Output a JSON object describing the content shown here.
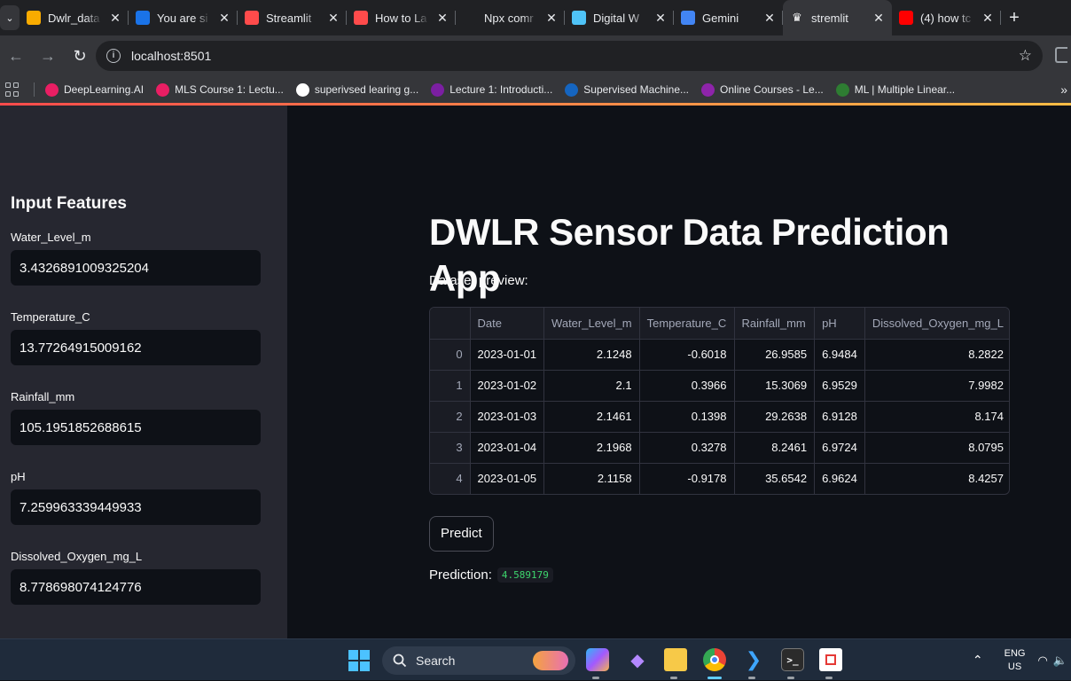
{
  "browser": {
    "tabs": [
      {
        "title": "Dwlr_data",
        "favicon": "infinity-icon",
        "color": "#f9ab00",
        "active": false
      },
      {
        "title": "You are si",
        "favicon": "s-icon",
        "color": "#1a73e8",
        "active": false
      },
      {
        "title": "Streamlit",
        "favicon": "crown-icon",
        "color": "#ff4b4b",
        "active": false
      },
      {
        "title": "How to La",
        "favicon": "crown-icon",
        "color": "#ff4b4b",
        "active": false
      },
      {
        "title": "Npx comr",
        "favicon": "openai-icon",
        "color": "#202124",
        "active": false
      },
      {
        "title": "Digital W",
        "favicon": "k-icon",
        "color": "#4fc3f7",
        "active": false
      },
      {
        "title": "Gemini",
        "favicon": "sparkle-icon",
        "color": "#4285f4",
        "active": false
      },
      {
        "title": "stremlit",
        "favicon": "crown-icon",
        "color": "#ffffff",
        "active": true
      },
      {
        "title": "(4) how tc",
        "favicon": "youtube-icon",
        "color": "#ff0000",
        "active": false
      }
    ],
    "new_tab_label": "+",
    "address": "localhost:8501",
    "bookmarks": [
      {
        "label": "DeepLearning.AI",
        "color": "#e91e63"
      },
      {
        "label": "MLS Course 1: Lectu...",
        "color": "#e91e63"
      },
      {
        "label": "superivsed learing g...",
        "color": "#ffffff"
      },
      {
        "label": "Lecture 1: Introducti...",
        "color": "#7b1fa2"
      },
      {
        "label": "Supervised Machine...",
        "color": "#1565c0"
      },
      {
        "label": "Online Courses - Le...",
        "color": "#8e24aa"
      },
      {
        "label": "ML | Multiple Linear...",
        "color": "#2e7d32"
      }
    ],
    "bookmarks_more": "»"
  },
  "sidebar": {
    "title": "Input Features",
    "fields": [
      {
        "label": "Water_Level_m",
        "value": "3.4326891009325204"
      },
      {
        "label": "Temperature_C",
        "value": "13.77264915009162"
      },
      {
        "label": "Rainfall_mm",
        "value": "105.1951852688615"
      },
      {
        "label": "pH",
        "value": "7.259963339449933"
      },
      {
        "label": "Dissolved_Oxygen_mg_L",
        "value": "8.778698074124776"
      }
    ]
  },
  "main": {
    "title": "DWLR Sensor Data Prediction App",
    "preview_caption": "Dataset preview:",
    "table": {
      "columns": [
        "",
        "Date",
        "Water_Level_m",
        "Temperature_C",
        "Rainfall_mm",
        "pH",
        "Dissolved_Oxygen_mg_L"
      ],
      "rows": [
        [
          "0",
          "2023-01-01",
          "2.1248",
          "-0.6018",
          "26.9585",
          "6.9484",
          "8.2822"
        ],
        [
          "1",
          "2023-01-02",
          "2.1",
          "0.3966",
          "15.3069",
          "6.9529",
          "7.9982"
        ],
        [
          "2",
          "2023-01-03",
          "2.1461",
          "0.1398",
          "29.2638",
          "6.9128",
          "8.174"
        ],
        [
          "3",
          "2023-01-04",
          "2.1968",
          "0.3278",
          "8.2461",
          "6.9724",
          "8.0795"
        ],
        [
          "4",
          "2023-01-05",
          "2.1158",
          "-0.9178",
          "35.6542",
          "6.9624",
          "8.4257"
        ]
      ]
    },
    "predict_label": "Predict",
    "prediction_label": "Prediction:",
    "prediction_value": "4.589179"
  },
  "taskbar": {
    "search_label": "Search",
    "lang_line1": "ENG",
    "lang_line2": "US"
  }
}
